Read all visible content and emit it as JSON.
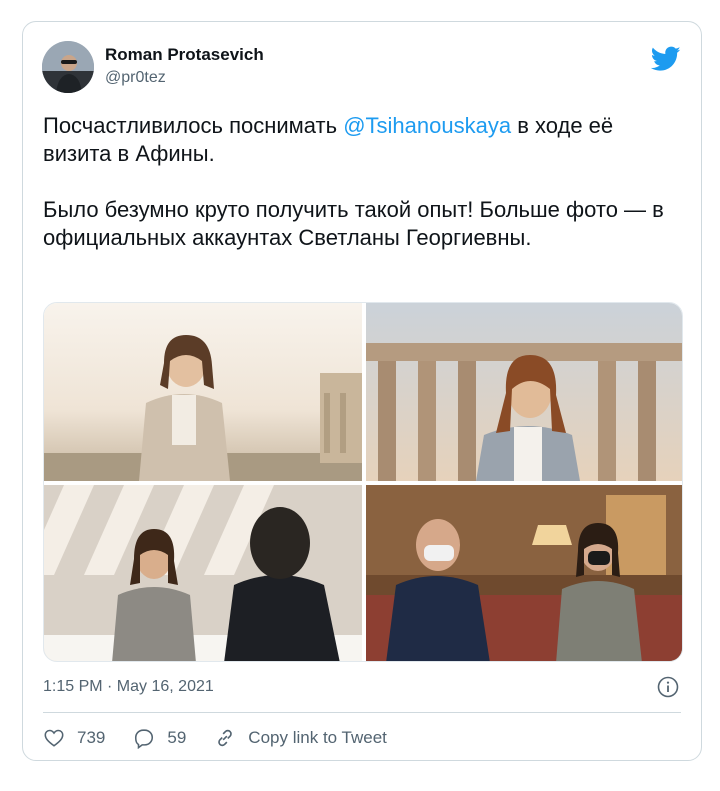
{
  "author": {
    "name": "Roman Protasevich",
    "handle": "@pr0tez"
  },
  "tweet": {
    "text_part1": "Посчастливилось поснимать ",
    "mention": "@Tsihanouskaya",
    "text_part2": " в ходе её визита в Афины.\n\nБыло безумно круто получить такой опыт! Больше фото — в официальных аккаунтах Светланы Георгиевны.",
    "timestamp": "1:15 PM · May 16, 2021"
  },
  "actions": {
    "likes": "739",
    "replies": "59",
    "copy_link": "Copy link to Tweet"
  },
  "colors": {
    "accent": "#1d9bf0",
    "secondary_text": "#536471",
    "border": "#cfd9de"
  },
  "icons": [
    "twitter-bird-icon",
    "info-icon",
    "heart-icon",
    "reply-icon",
    "link-icon"
  ]
}
